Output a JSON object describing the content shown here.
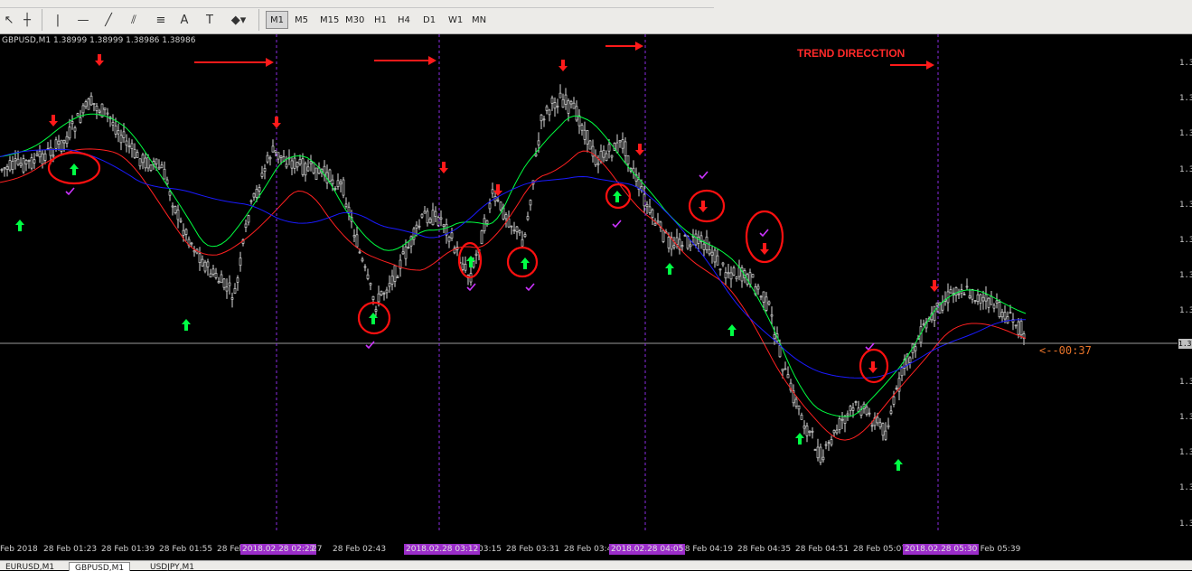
{
  "toolbar": {
    "tools": [
      "cursor-icon",
      "crosshair-icon",
      "vertical-line-icon",
      "horizontal-line-icon",
      "trendline-icon",
      "channel-icon",
      "fibonacci-icon",
      "text-icon",
      "text-label-icon",
      "arrows-icon"
    ],
    "timeframes": [
      "M1",
      "M5",
      "M15",
      "M30",
      "H1",
      "H4",
      "D1",
      "W1",
      "MN"
    ],
    "active_timeframe": "M1"
  },
  "chart": {
    "symbol_info": "GBPUSD,M1  1.38999 1.38999 1.38986 1.38986",
    "annotation": "TREND DIRECCTION",
    "countdown": "<--00:37",
    "price_axis_ticks": [
      "1.3",
      "1.3",
      "1.3",
      "1.3",
      "1.3",
      "1.3",
      "1.3",
      "1.3",
      "1.3",
      "1.3",
      "1.3",
      "1.3",
      "1.3",
      "1.3"
    ],
    "current_price_tag": "1.3",
    "colors": {
      "background": "#000000",
      "candles": "#d9d9d9",
      "ma_fast": "#00ff40",
      "ma_mid": "#ff2020",
      "ma_slow": "#1a1aff",
      "arrow_up": "#00ff44",
      "arrow_down": "#ff1a1a",
      "check": "#cc33ff",
      "separator": "#8a2be2",
      "annotation": "#ff2a2a",
      "countdown": "#e8742a"
    }
  },
  "time_axis": {
    "labels": [
      "Feb 2018",
      "28 Feb 01:23",
      "28 Feb 01:39",
      "28 Feb 01:55",
      "28 Feb",
      "28 Feb 02:43",
      "03:15",
      "28 Feb 03:31",
      "28 Feb 03:4",
      "28 Feb 04:19",
      "28 Feb 04:35",
      "28 Feb 04:51",
      "28 Feb 05:07",
      "8 Feb 05:39"
    ],
    "highlights": [
      "2018.02.28 02:27",
      ":27",
      "2018.02.28 03:12",
      "2018.02.28 04:05",
      "2018.02.28 05:30"
    ]
  },
  "tabs": [
    "EURUSD,M1",
    "GBPUSD,M1",
    "USDJPY,M1"
  ],
  "active_tab": "GBPUSD,M1"
}
